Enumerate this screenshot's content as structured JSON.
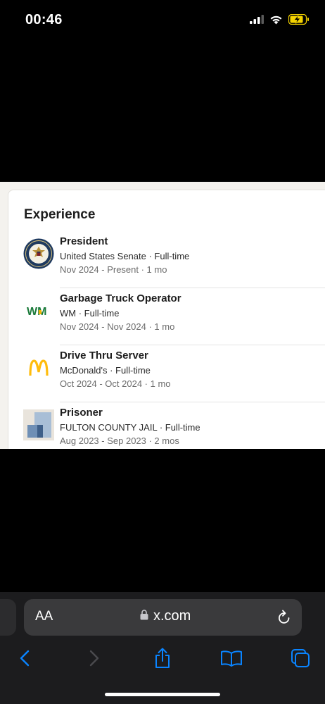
{
  "status_bar": {
    "time": "00:46"
  },
  "experience": {
    "title": "Experience",
    "entries": [
      {
        "title": "President",
        "company": "United States Senate · Full-time",
        "dates": "Nov 2024 - Present · 1 mo",
        "logo_icon": "us-senate-seal-icon"
      },
      {
        "title": "Garbage Truck Operator",
        "company": "WM · Full-time",
        "dates": "Nov 2024 - Nov 2024 · 1 mo",
        "logo_icon": "wm-logo-icon",
        "logo_text": "WM"
      },
      {
        "title": "Drive Thru Server",
        "company": "McDonald's · Full-time",
        "dates": "Oct 2024 - Oct 2024 · 1 mo",
        "logo_icon": "mcdonalds-logo-icon",
        "logo_text": "M"
      },
      {
        "title": "Prisoner",
        "company": "FULTON COUNTY JAIL · Full-time",
        "dates": "Aug 2023 - Sep 2023 · 2 mos",
        "logo_icon": "company-placeholder-icon"
      }
    ]
  },
  "browser": {
    "text_size_label": "AA",
    "url": "x.com"
  },
  "colors": {
    "accent": "#0a84ff",
    "wm_green": "#1a7a3a",
    "wm_yellow": "#f2b705",
    "mcdonalds_yellow": "#ffbc0d"
  }
}
